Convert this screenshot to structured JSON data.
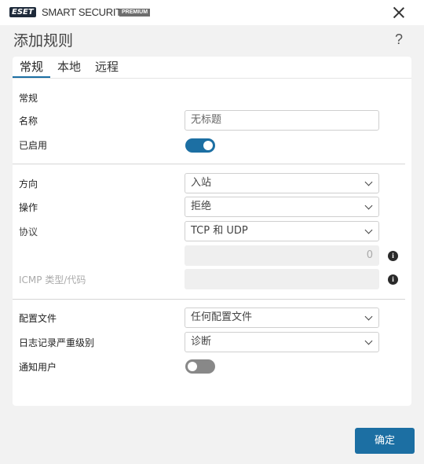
{
  "window": {
    "logo_text": "ESET",
    "brand": "SMART SECURITY",
    "edition": "PREMIUM"
  },
  "dialog": {
    "title": "添加规则",
    "help": "?"
  },
  "tabs": [
    {
      "label": "常规",
      "active": true
    },
    {
      "label": "本地",
      "active": false
    },
    {
      "label": "远程",
      "active": false
    }
  ],
  "general": {
    "section_title": "常规",
    "name_label": "名称",
    "name_value": "无标题",
    "enabled_label": "已启用",
    "enabled": true
  },
  "rule": {
    "direction_label": "方向",
    "direction_value": "入站",
    "action_label": "操作",
    "action_value": "拒绝",
    "protocol_label": "协议",
    "protocol_value": "TCP 和 UDP",
    "port_value": "0",
    "icmp_label": "ICMP 类型/代码",
    "icmp_value": ""
  },
  "profile": {
    "profile_label": "配置文件",
    "profile_value": "任何配置文件",
    "log_label": "日志记录严重级别",
    "log_value": "诊断",
    "notify_label": "通知用户",
    "notify": false
  },
  "footer": {
    "ok_label": "确定"
  },
  "colors": {
    "accent": "#1c6fa3",
    "toggle_off": "#888888",
    "background": "#f2f2f2"
  }
}
